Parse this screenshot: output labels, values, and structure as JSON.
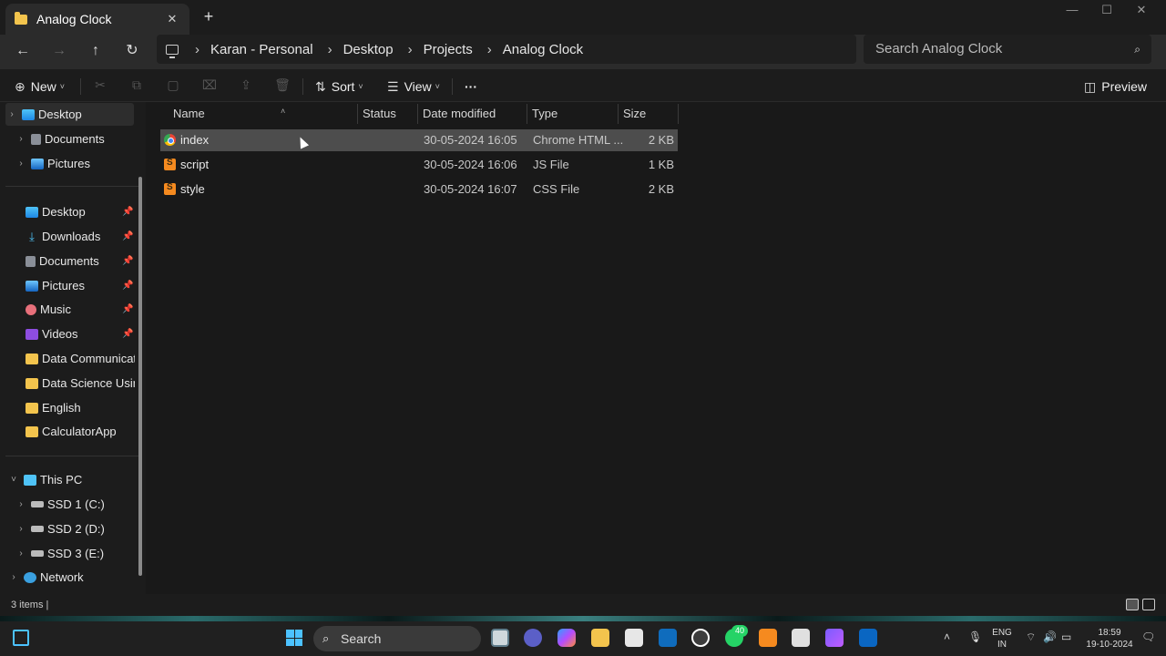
{
  "tab": {
    "title": "Analog Clock",
    "close_label": "✕",
    "new_tab_label": "+"
  },
  "window_controls": {
    "minimize": "—",
    "maximize": "☐",
    "close": "✕"
  },
  "breadcrumb": [
    "Karan - Personal",
    "Desktop",
    "Projects",
    "Analog Clock"
  ],
  "search": {
    "placeholder": "Search Analog Clock"
  },
  "toolbar": {
    "new_label": "New",
    "sort_label": "Sort",
    "view_label": "View",
    "more_label": "···",
    "preview_label": "Preview"
  },
  "sidebar": {
    "top": [
      {
        "label": "Desktop",
        "icon": "desktop-icon"
      },
      {
        "label": "Documents",
        "icon": "documents-icon"
      },
      {
        "label": "Pictures",
        "icon": "pictures-icon"
      }
    ],
    "quick_access": [
      {
        "label": "Desktop",
        "icon": "desktop-icon",
        "pinned": true
      },
      {
        "label": "Downloads",
        "icon": "downloads-icon",
        "pinned": true
      },
      {
        "label": "Documents",
        "icon": "documents-icon",
        "pinned": true
      },
      {
        "label": "Pictures",
        "icon": "pictures-icon",
        "pinned": true
      },
      {
        "label": "Music",
        "icon": "music-icon",
        "pinned": true
      },
      {
        "label": "Videos",
        "icon": "videos-icon",
        "pinned": true
      },
      {
        "label": "Data Communicatio",
        "icon": "folder-icon",
        "pinned": false
      },
      {
        "label": "Data Science Using",
        "icon": "folder-icon",
        "pinned": false
      },
      {
        "label": "English",
        "icon": "folder-icon",
        "pinned": false
      },
      {
        "label": "CalculatorApp",
        "icon": "folder-icon",
        "pinned": false
      }
    ],
    "this_pc": {
      "label": "This PC"
    },
    "drives": [
      {
        "label": "SSD 1 (C:)"
      },
      {
        "label": "SSD 2 (D:)"
      },
      {
        "label": "SSD 3 (E:)"
      }
    ],
    "network": {
      "label": "Network"
    }
  },
  "columns": {
    "name": "Name",
    "status": "Status",
    "date_modified": "Date modified",
    "type": "Type",
    "size": "Size"
  },
  "files": [
    {
      "name": "index",
      "date_modified": "30-05-2024 16:05",
      "type": "Chrome HTML ...",
      "size": "2 KB",
      "icon": "chrome-html-icon",
      "selected": true
    },
    {
      "name": "script",
      "date_modified": "30-05-2024 16:06",
      "type": "JS File",
      "size": "1 KB",
      "icon": "sublime-file-icon",
      "selected": false
    },
    {
      "name": "style",
      "date_modified": "30-05-2024 16:07",
      "type": "CSS File",
      "size": "2 KB",
      "icon": "sublime-file-icon",
      "selected": false
    }
  ],
  "status": {
    "item_count": "3 items"
  },
  "taskbar": {
    "search_label": "Search",
    "whatsapp_badge": "40",
    "language_top": "ENG",
    "language_bottom": "IN",
    "time": "18:59",
    "date": "19-10-2024"
  },
  "colors": {
    "accent": "#4cc2ff",
    "folder": "#f3c44d",
    "selection": "#4d4d4d"
  }
}
